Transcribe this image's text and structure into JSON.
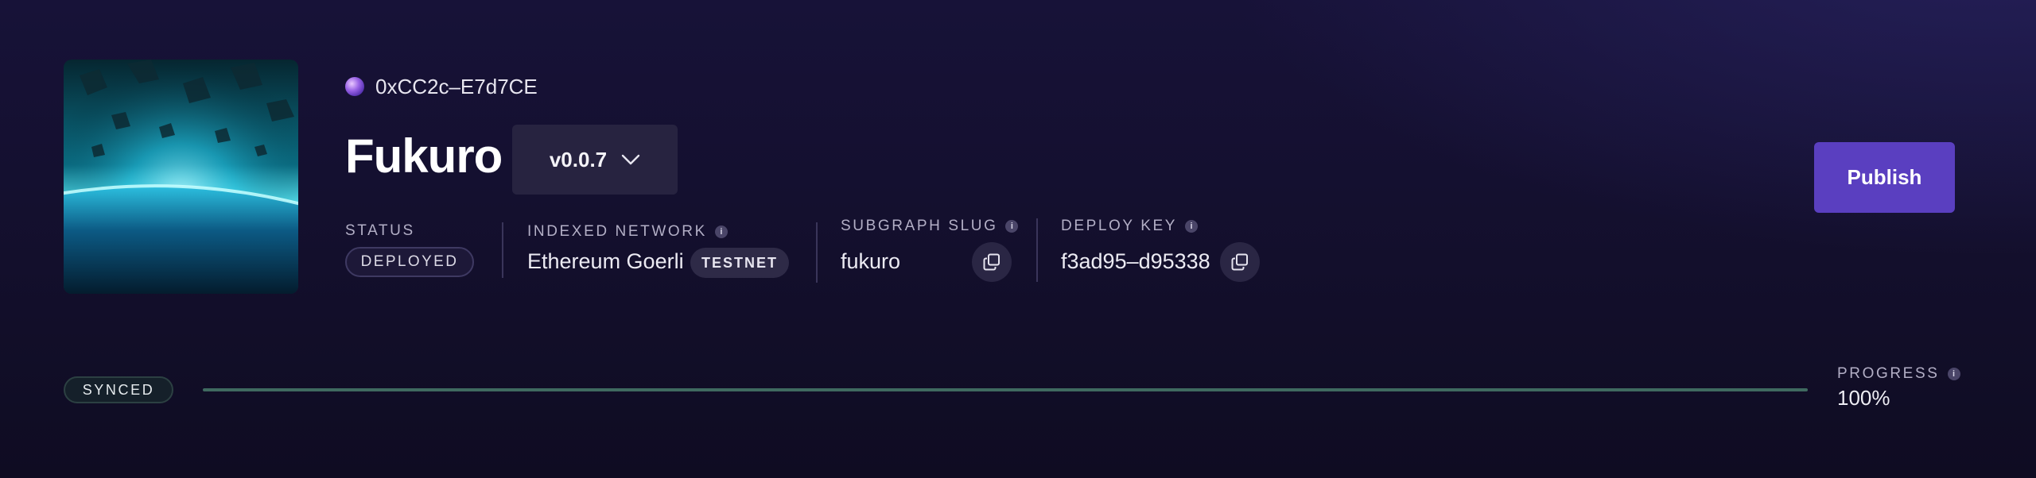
{
  "header": {
    "address": "0xCC2c–E7d7CE",
    "title": "Fukuro",
    "version": "v0.0.7"
  },
  "meta": {
    "status": {
      "label": "STATUS",
      "value": "DEPLOYED"
    },
    "indexed_network": {
      "label": "INDEXED NETWORK",
      "value": "Ethereum Goerli",
      "badge": "TESTNET"
    },
    "subgraph_slug": {
      "label": "SUBGRAPH SLUG",
      "value": "fukuro"
    },
    "deploy_key": {
      "label": "DEPLOY KEY",
      "value": "f3ad95–d95338"
    }
  },
  "actions": {
    "publish_label": "Publish"
  },
  "sync": {
    "status": "SYNCED",
    "progress_label": "PROGRESS",
    "progress_text": "100%",
    "progress_fraction": 1.0
  },
  "icons": {
    "info": "i",
    "avatar": "purple-orb-icon",
    "chevron": "chevron-down-icon",
    "copy": "copy-icon"
  },
  "colors": {
    "accent": "#5a3fc0",
    "progress": "#3f6a60",
    "background": "#151030"
  }
}
